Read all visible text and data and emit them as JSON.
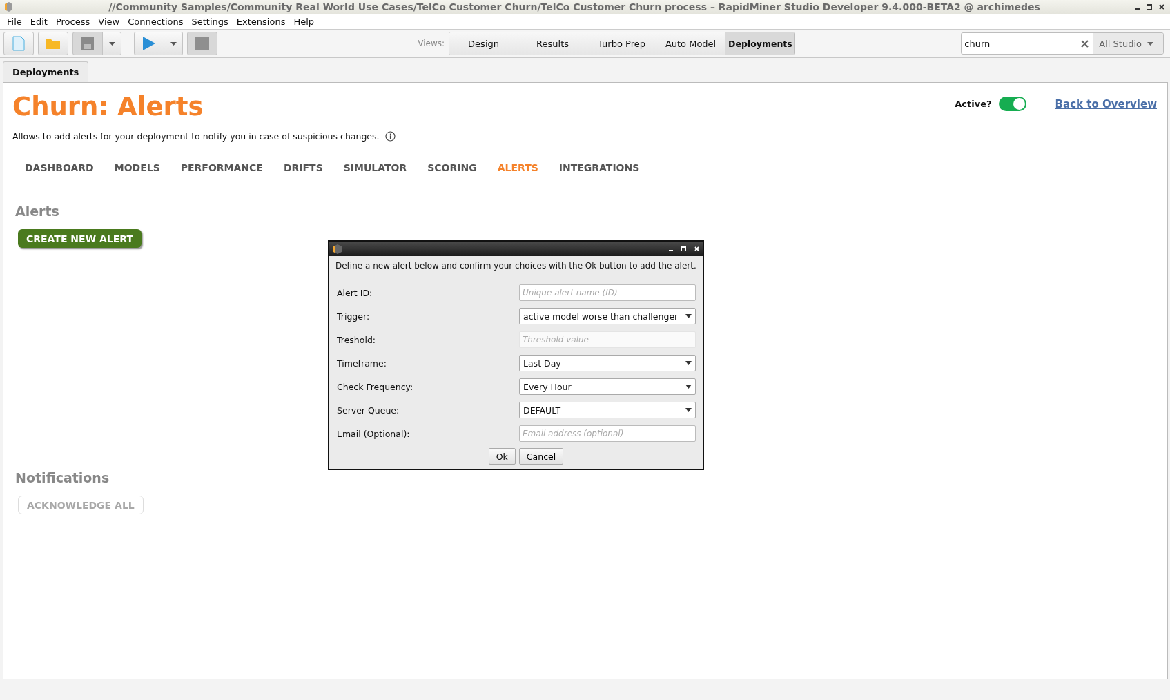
{
  "window": {
    "title": "//Community Samples/Community Real World Use Cases/TelCo Customer Churn/TelCo Customer Churn process – RapidMiner Studio Developer 9.4.000-BETA2 @ archimedes"
  },
  "menu": [
    "File",
    "Edit",
    "Process",
    "View",
    "Connections",
    "Settings",
    "Extensions",
    "Help"
  ],
  "toolbar": {
    "views_label": "Views:",
    "views": [
      {
        "label": "Design",
        "selected": false
      },
      {
        "label": "Results",
        "selected": false
      },
      {
        "label": "Turbo Prep",
        "selected": false
      },
      {
        "label": "Auto Model",
        "selected": false
      },
      {
        "label": "Deployments",
        "selected": true
      }
    ],
    "search": {
      "value": "churn"
    },
    "scope": "All Studio"
  },
  "panel_tab": "Deployments",
  "page": {
    "title": "Churn: Alerts",
    "description": "Allows to add alerts for your deployment to notify you in case of suspicious changes.",
    "active_label": "Active?",
    "active": true,
    "back_link": "Back to Overview",
    "tabs": [
      {
        "label": "DASHBOARD",
        "selected": false
      },
      {
        "label": "MODELS",
        "selected": false
      },
      {
        "label": "PERFORMANCE",
        "selected": false
      },
      {
        "label": "DRIFTS",
        "selected": false
      },
      {
        "label": "SIMULATOR",
        "selected": false
      },
      {
        "label": "SCORING",
        "selected": false
      },
      {
        "label": "ALERTS",
        "selected": true
      },
      {
        "label": "INTEGRATIONS",
        "selected": false
      }
    ],
    "alerts_heading": "Alerts",
    "create_button": "CREATE NEW ALERT",
    "notifications_heading": "Notifications",
    "acknowledge_button": {
      "label": "ACKNOWLEDGE ALL",
      "disabled": true
    }
  },
  "dialog": {
    "intro": "Define a new alert below and confirm your choices with the Ok button to add the alert.",
    "fields": [
      {
        "label": "Alert ID:",
        "kind": "text",
        "placeholder": "Unique alert name (ID)",
        "disabled": false
      },
      {
        "label": "Trigger:",
        "kind": "select",
        "value": "active model worse than challenger"
      },
      {
        "label": "Treshold:",
        "kind": "text",
        "placeholder": "Threshold value",
        "disabled": true
      },
      {
        "label": "Timeframe:",
        "kind": "select",
        "value": "Last Day"
      },
      {
        "label": "Check Frequency:",
        "kind": "select",
        "value": "Every Hour"
      },
      {
        "label": "Server Queue:",
        "kind": "select",
        "value": "DEFAULT"
      },
      {
        "label": "Email (Optional):",
        "kind": "text",
        "placeholder": "Email address (optional)",
        "disabled": false
      }
    ],
    "buttons": [
      "Ok",
      "Cancel"
    ]
  }
}
